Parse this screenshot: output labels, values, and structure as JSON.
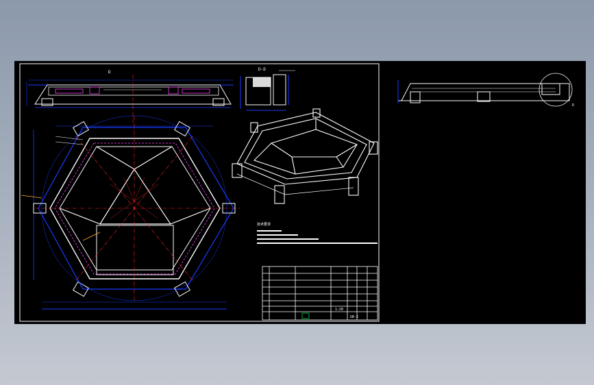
{
  "views": {
    "top_view_label": "D",
    "section_label": "D-D",
    "detail_label": "D"
  },
  "notes": {
    "heading": "技术要求"
  },
  "title_block": {
    "drawing_no": "GB-2",
    "scale": "1:20"
  },
  "colors": {
    "background": "#000000",
    "frame": "#ffffff",
    "dimension": "#1a3cff",
    "centerline": "#ff2a2a",
    "hidden": "#ff40ff",
    "leader": "#ffaa22",
    "stamp": "#00cc44"
  }
}
